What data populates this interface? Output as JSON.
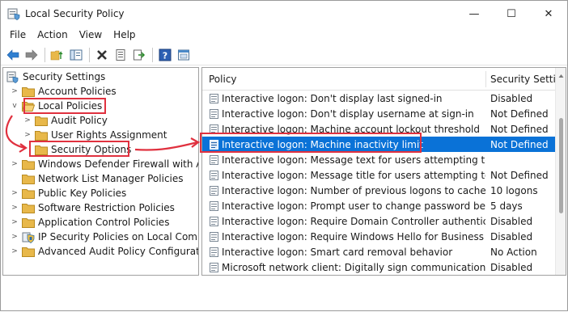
{
  "window": {
    "title": "Local Security Policy",
    "controls": [
      "—",
      "☐",
      "✕"
    ]
  },
  "menu": [
    "File",
    "Action",
    "View",
    "Help"
  ],
  "toolbar_icons": [
    "back-arrow-icon",
    "forward-arrow-icon",
    "up-folder-icon",
    "show-hide-tree-icon",
    "delete-icon",
    "properties-icon",
    "export-list-icon",
    "help-icon",
    "help-topics-icon"
  ],
  "tree": {
    "root": "Security Settings",
    "items": [
      {
        "label": "Account Policies",
        "level": 1
      },
      {
        "label": "Local Policies",
        "level": 1
      },
      {
        "label": "Audit Policy",
        "level": 2
      },
      {
        "label": "User Rights Assignment",
        "level": 2
      },
      {
        "label": "Security Options",
        "level": 2
      },
      {
        "label": "Windows Defender Firewall with Adva",
        "level": 1
      },
      {
        "label": "Network List Manager Policies",
        "level": 1
      },
      {
        "label": "Public Key Policies",
        "level": 1
      },
      {
        "label": "Software Restriction Policies",
        "level": 1
      },
      {
        "label": "Application Control Policies",
        "level": 1
      },
      {
        "label": "IP Security Policies on Local Compute",
        "level": 1
      },
      {
        "label": "Advanced Audit Policy Configuration",
        "level": 1
      }
    ]
  },
  "list": {
    "columns": [
      "Policy",
      "Security Settin"
    ],
    "rows": [
      {
        "policy": "Interactive logon: Don't display last signed-in",
        "setting": "Disabled"
      },
      {
        "policy": "Interactive logon: Don't display username at sign-in",
        "setting": "Not Defined"
      },
      {
        "policy": "Interactive logon: Machine account lockout threshold",
        "setting": "Not Defined"
      },
      {
        "policy": "Interactive logon: Machine inactivity limit",
        "setting": "Not Defined"
      },
      {
        "policy": "Interactive logon: Message text for users attempting to log on",
        "setting": ""
      },
      {
        "policy": "Interactive logon: Message title for users attempting to log on",
        "setting": "Not Defined"
      },
      {
        "policy": "Interactive logon: Number of previous logons to cache (in c...",
        "setting": "10 logons"
      },
      {
        "policy": "Interactive logon: Prompt user to change password before e...",
        "setting": "5 days"
      },
      {
        "policy": "Interactive logon: Require Domain Controller authentication...",
        "setting": "Disabled"
      },
      {
        "policy": "Interactive logon: Require Windows Hello for Business or sm...",
        "setting": "Disabled"
      },
      {
        "policy": "Interactive logon: Smart card removal behavior",
        "setting": "No Action"
      },
      {
        "policy": "Microsoft network client: Digitally sign communications (al...",
        "setting": "Disabled"
      }
    ],
    "selected_index": 3
  },
  "colors": {
    "selection": "#0a72d7",
    "annotation": "#e0313f",
    "folder": "#e8b84a"
  }
}
